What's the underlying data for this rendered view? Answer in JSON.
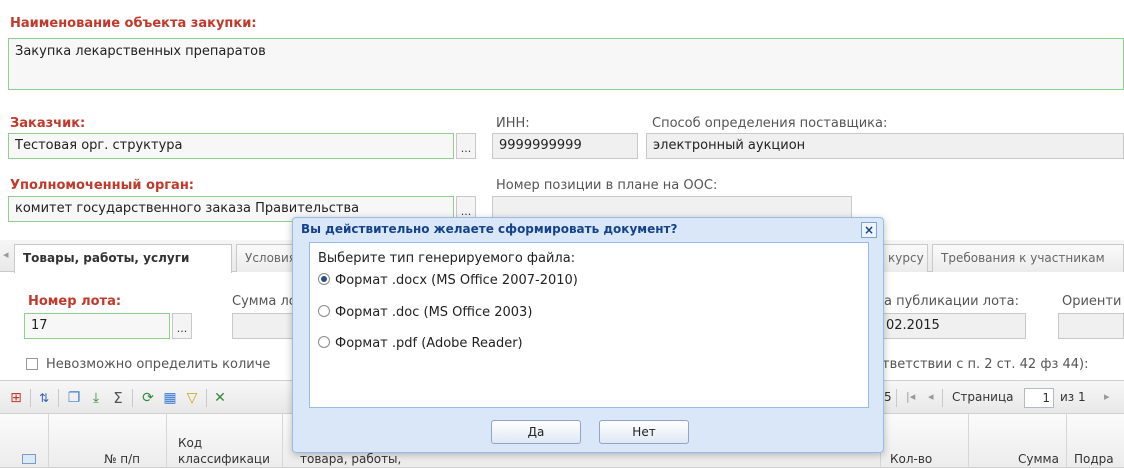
{
  "form": {
    "object_label": "Наименование объекта закупки:",
    "object_value": "Закупка лекарственных препаратов",
    "customer_label": "Заказчик:",
    "customer_value": "Тестовая орг. структура",
    "inn_label": "ИНН:",
    "inn_value": "9999999999",
    "method_label": "Способ определения поставщика:",
    "method_value": "электронный аукцион",
    "authority_label": "Уполномоченный орган:",
    "authority_value": "комитет государственного заказа Правительства",
    "position_label": "Номер позиции в плане на ООС:",
    "dots": "..."
  },
  "tabs": {
    "arrow": "◂",
    "items": [
      {
        "label": "Товары, работы, услуги"
      },
      {
        "label": "Условия"
      },
      {
        "label": "курсу"
      },
      {
        "label": "Требования к участникам"
      }
    ]
  },
  "lot": {
    "number_label": "Номер лота:",
    "number_value": "17",
    "sum_label": "Сумма ло",
    "pub_label": "а публикации лота:",
    "pub_value": "02.2015",
    "orient_label": "Ориенти",
    "cannot_label": "Невозможно определить количе",
    "accordance_label": "тветствии с п. 2 ст. 42 фз 44):"
  },
  "toolbar": {
    "page_number_partial": "5",
    "page_label": "Страница",
    "page_value": "1",
    "of_label": "из 1",
    "first_icon": "|◂",
    "prev_icon": "◂",
    "next_icon": "▸"
  },
  "grid": {
    "col_num": "№ п/п",
    "col_code_1": "Код",
    "col_code_2": "классификаци",
    "col_goods": "товара, работы,",
    "col_qty": "Кол-во",
    "col_sum": "Сумма",
    "col_sub": "Подра"
  },
  "dialog": {
    "title": "Вы действительно желаете сформировать документ?",
    "close": "×",
    "prompt": "Выберите тип генерируемого файла:",
    "options": [
      {
        "label": "Формат .docx (MS Office 2007-2010)",
        "checked": true
      },
      {
        "label": "Формат .doc (MS Office 2003)",
        "checked": false
      },
      {
        "label": "Формат .pdf (Adobe Reader)",
        "checked": false
      }
    ],
    "yes_label": "Да",
    "no_label": "Нет"
  },
  "colors": {
    "label_red": "#c0392b",
    "dialog_bg": "#d9e7f8",
    "dialog_title": "#15428b",
    "field_green_border": "#8fcf8f"
  }
}
